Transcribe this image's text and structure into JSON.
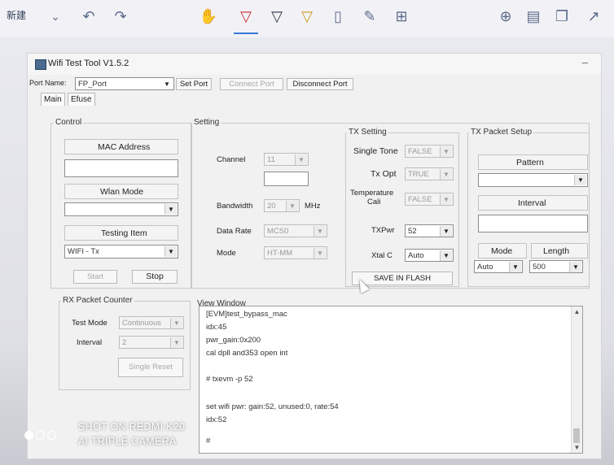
{
  "toolbar": {
    "new_label": "新建",
    "icons": [
      "chevron-down-icon",
      "undo-icon",
      "redo-icon",
      "hand-icon",
      "pen-red-icon",
      "pen-dark-icon",
      "highlighter-icon",
      "eraser-icon",
      "pencil-icon",
      "crop-icon",
      "zoom-icon",
      "save-icon",
      "copy-icon",
      "share-icon"
    ]
  },
  "window": {
    "title": "Wifi Test Tool V1.5.2",
    "minimize": "–",
    "port_name_label": "Port Name:",
    "port_value": "FP_Port",
    "set_port": "Set Port",
    "connect_port": "Connect Port",
    "disconnect_port": "Disconnect Port",
    "tabs": [
      "Main",
      "Efuse"
    ]
  },
  "control": {
    "legend": "Control",
    "mac_address": "MAC Address",
    "mac_value": "",
    "wlan_mode": "Wlan Mode",
    "wlan_value": "",
    "testing_item": "Testing Item",
    "testing_value": "WIFI - Tx",
    "start": "Start",
    "stop": "Stop"
  },
  "setting": {
    "legend": "Setting",
    "channel_label": "Channel",
    "channel_value": "11",
    "channel_extra": "",
    "bandwidth_label": "Bandwidth",
    "bandwidth_value": "20",
    "bandwidth_unit": "MHz",
    "data_rate_label": "Data Rate",
    "data_rate_value": "MCS0",
    "mode_label": "Mode",
    "mode_value": "HT-MM"
  },
  "tx_setting": {
    "legend": "TX Setting",
    "single_tone_label": "Single Tone",
    "single_tone_value": "FALSE",
    "tx_opt_label": "Tx Opt",
    "tx_opt_value": "TRUE",
    "temp_cali_label_1": "Temperature",
    "temp_cali_label_2": "Cali",
    "temp_cali_value": "FALSE",
    "txpwr_label": "TXPwr",
    "txpwr_value": "52",
    "xtal_label": "Xtal C",
    "xtal_value": "Auto",
    "save_flash": "SAVE IN FLASH"
  },
  "tx_packet": {
    "legend": "TX Packet Setup",
    "pattern": "Pattern",
    "pattern_value": "",
    "interval": "Interval",
    "interval_value": "",
    "mode": "Mode",
    "length": "Length",
    "mode_value": "Auto",
    "length_value": "500"
  },
  "rx_counter": {
    "legend": "RX Packet Counter",
    "test_mode_label": "Test Mode",
    "test_mode_value": "Continuous",
    "interval_label": "Interval",
    "interval_value": "2",
    "single_reset": "Single Reset"
  },
  "view_window": {
    "legend": "View Window",
    "lines": [
      "[EVM]test_bypass_mac",
      "idx:45",
      "pwr_gain:0x200",
      "cal dpll and353 open int",
      "",
      "# txevm -p 52",
      "",
      "",
      "set wifi pwr: gain:52, unused:0, rate:54",
      "idx:52",
      "",
      "#"
    ]
  },
  "watermark": {
    "line1": "SHOT ON REDMI K20",
    "line2": "AI TRIPLE CAMERA"
  }
}
